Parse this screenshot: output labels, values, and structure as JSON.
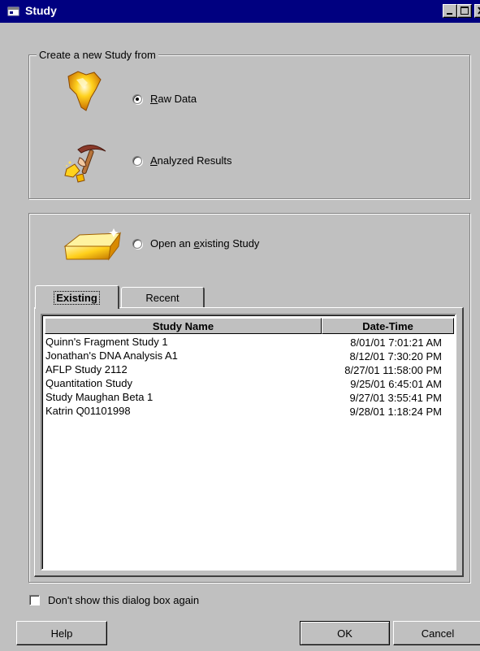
{
  "window": {
    "title": "Study",
    "icon": "study-window-icon",
    "controls": [
      "minimize-icon",
      "maximize-icon",
      "close-icon"
    ]
  },
  "create_group": {
    "legend": "Create a new Study from",
    "options": [
      {
        "label": "Raw Data",
        "mnemonic": "R",
        "rest": "aw Data",
        "checked": true,
        "icon": "raw-data-nugget-icon"
      },
      {
        "label": "Analyzed Results",
        "mnemonic": "A",
        "rest": "nalyzed Results",
        "checked": false,
        "icon": "pickaxe-icon"
      }
    ]
  },
  "open_group": {
    "option": {
      "label": "Open an existing Study",
      "pre": "Open an ",
      "mnemonic": "e",
      "rest": "xisting Study",
      "checked": false,
      "icon": "gold-bar-icon"
    },
    "tabs": [
      {
        "label": "Existing",
        "active": true
      },
      {
        "label": "Recent",
        "active": false
      }
    ],
    "table": {
      "columns": [
        "Study Name",
        "Date-Time"
      ],
      "rows": [
        {
          "name": "Quinn's Fragment Study 1",
          "date": "8/01/01 7:01:21 AM"
        },
        {
          "name": "Jonathan's DNA Analysis A1",
          "date": "8/12/01 7:30:20 PM"
        },
        {
          "name": "AFLP Study 2112",
          "date": "8/27/01 11:58:00 PM"
        },
        {
          "name": "Quantitation Study",
          "date": "9/25/01 6:45:01 AM"
        },
        {
          "name": "Study Maughan Beta 1",
          "date": "9/27/01 3:55:41 PM"
        },
        {
          "name": "Katrin Q01101998",
          "date": "9/28/01 1:18:24 PM"
        }
      ]
    }
  },
  "dont_show": {
    "label": "Don't show this dialog box again",
    "checked": false
  },
  "buttons": {
    "help": "Help",
    "ok": "OK",
    "cancel": "Cancel"
  },
  "colors": {
    "titlebar": "#000080",
    "face": "#c0c0c0",
    "gold": "#f5b800"
  }
}
